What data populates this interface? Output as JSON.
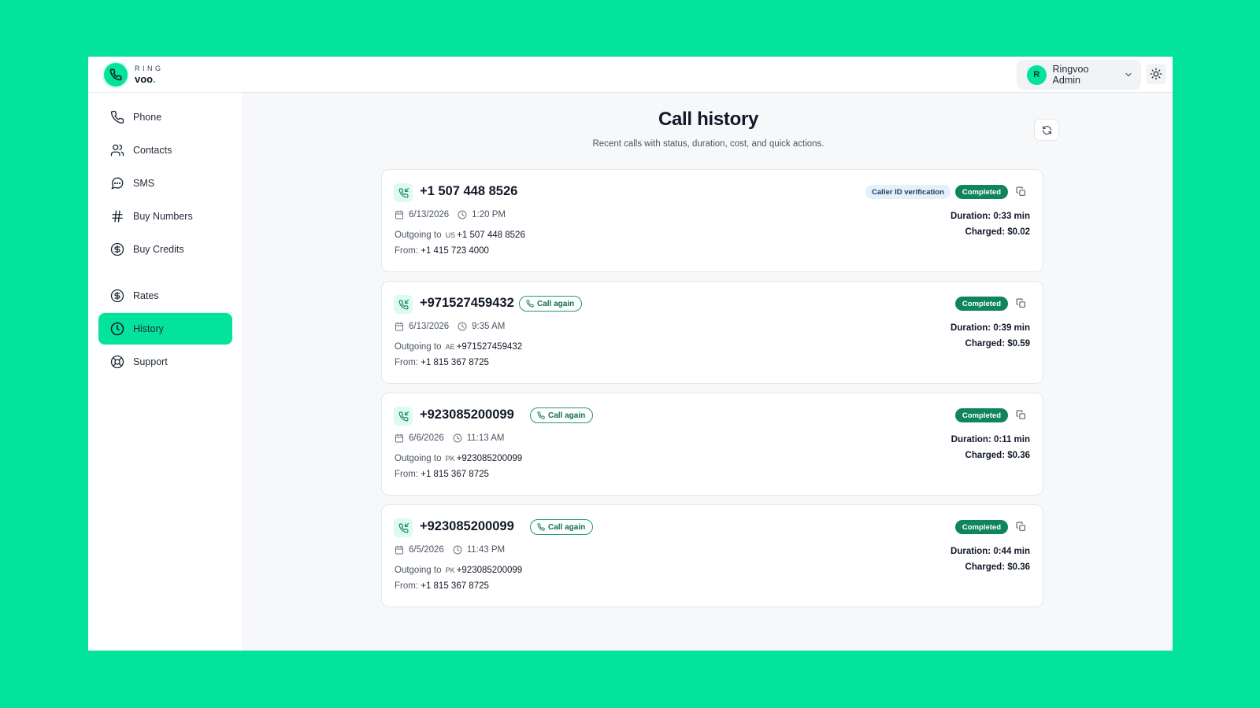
{
  "brand": {
    "line1": "RING",
    "line2": "voo",
    "dot": "."
  },
  "user": {
    "initial": "R",
    "name": "Ringvoo Admin"
  },
  "sidebar": {
    "items": [
      {
        "label": "Phone",
        "icon": "phone-icon"
      },
      {
        "label": "Contacts",
        "icon": "contacts-icon"
      },
      {
        "label": "SMS",
        "icon": "sms-icon"
      },
      {
        "label": "Buy Numbers",
        "icon": "hash-icon"
      },
      {
        "label": "Buy Credits",
        "icon": "dollar-circle-icon"
      },
      {
        "label": "Rates",
        "icon": "dollar-circle-icon"
      },
      {
        "label": "History",
        "icon": "clock-icon",
        "active": true
      },
      {
        "label": "Support",
        "icon": "lifebuoy-icon"
      }
    ]
  },
  "main": {
    "title": "Call history",
    "subtitle": "Recent calls with status, duration, cost, and quick actions."
  },
  "calls": [
    {
      "number": "+1 507 448 8526",
      "call_again": null,
      "tag": "Caller ID verification",
      "status": "Completed",
      "date": "6/13/2026",
      "time": "1:20 PM",
      "outgoing_prefix": "Outgoing to",
      "country": "US",
      "to": "+1 507 448 8526",
      "from_prefix": "From:",
      "from": "+1 415 723 4000",
      "duration": "Duration: 0:33 min",
      "charged": "Charged: $0.02"
    },
    {
      "number": "+971527459432",
      "call_again": "Call again",
      "tag": null,
      "status": "Completed",
      "date": "6/13/2026",
      "time": "9:35 AM",
      "outgoing_prefix": "Outgoing to",
      "country": "AE",
      "to": "+971527459432",
      "from_prefix": "From:",
      "from": "+1 815 367 8725",
      "duration": "Duration: 0:39 min",
      "charged": "Charged: $0.59"
    },
    {
      "number": "+923085200099",
      "call_again": "Call again",
      "tag": null,
      "status": "Completed",
      "date": "6/6/2026",
      "time": "11:13 AM",
      "outgoing_prefix": "Outgoing to",
      "country": "PK",
      "to": "+923085200099",
      "from_prefix": "From:",
      "from": "+1 815 367 8725",
      "duration": "Duration: 0:11 min",
      "charged": "Charged: $0.36"
    },
    {
      "number": "+923085200099",
      "call_again": "Call again",
      "tag": null,
      "status": "Completed",
      "date": "6/5/2026",
      "time": "11:43 PM",
      "outgoing_prefix": "Outgoing to",
      "country": "PK",
      "to": "+923085200099",
      "from_prefix": "From:",
      "from": "+1 815 367 8725",
      "duration": "Duration: 0:44 min",
      "charged": "Charged: $0.36"
    }
  ],
  "colors": {
    "brand_green": "#03e39c",
    "status_green": "#10855b",
    "info_badge_bg": "#e3f1fb"
  }
}
